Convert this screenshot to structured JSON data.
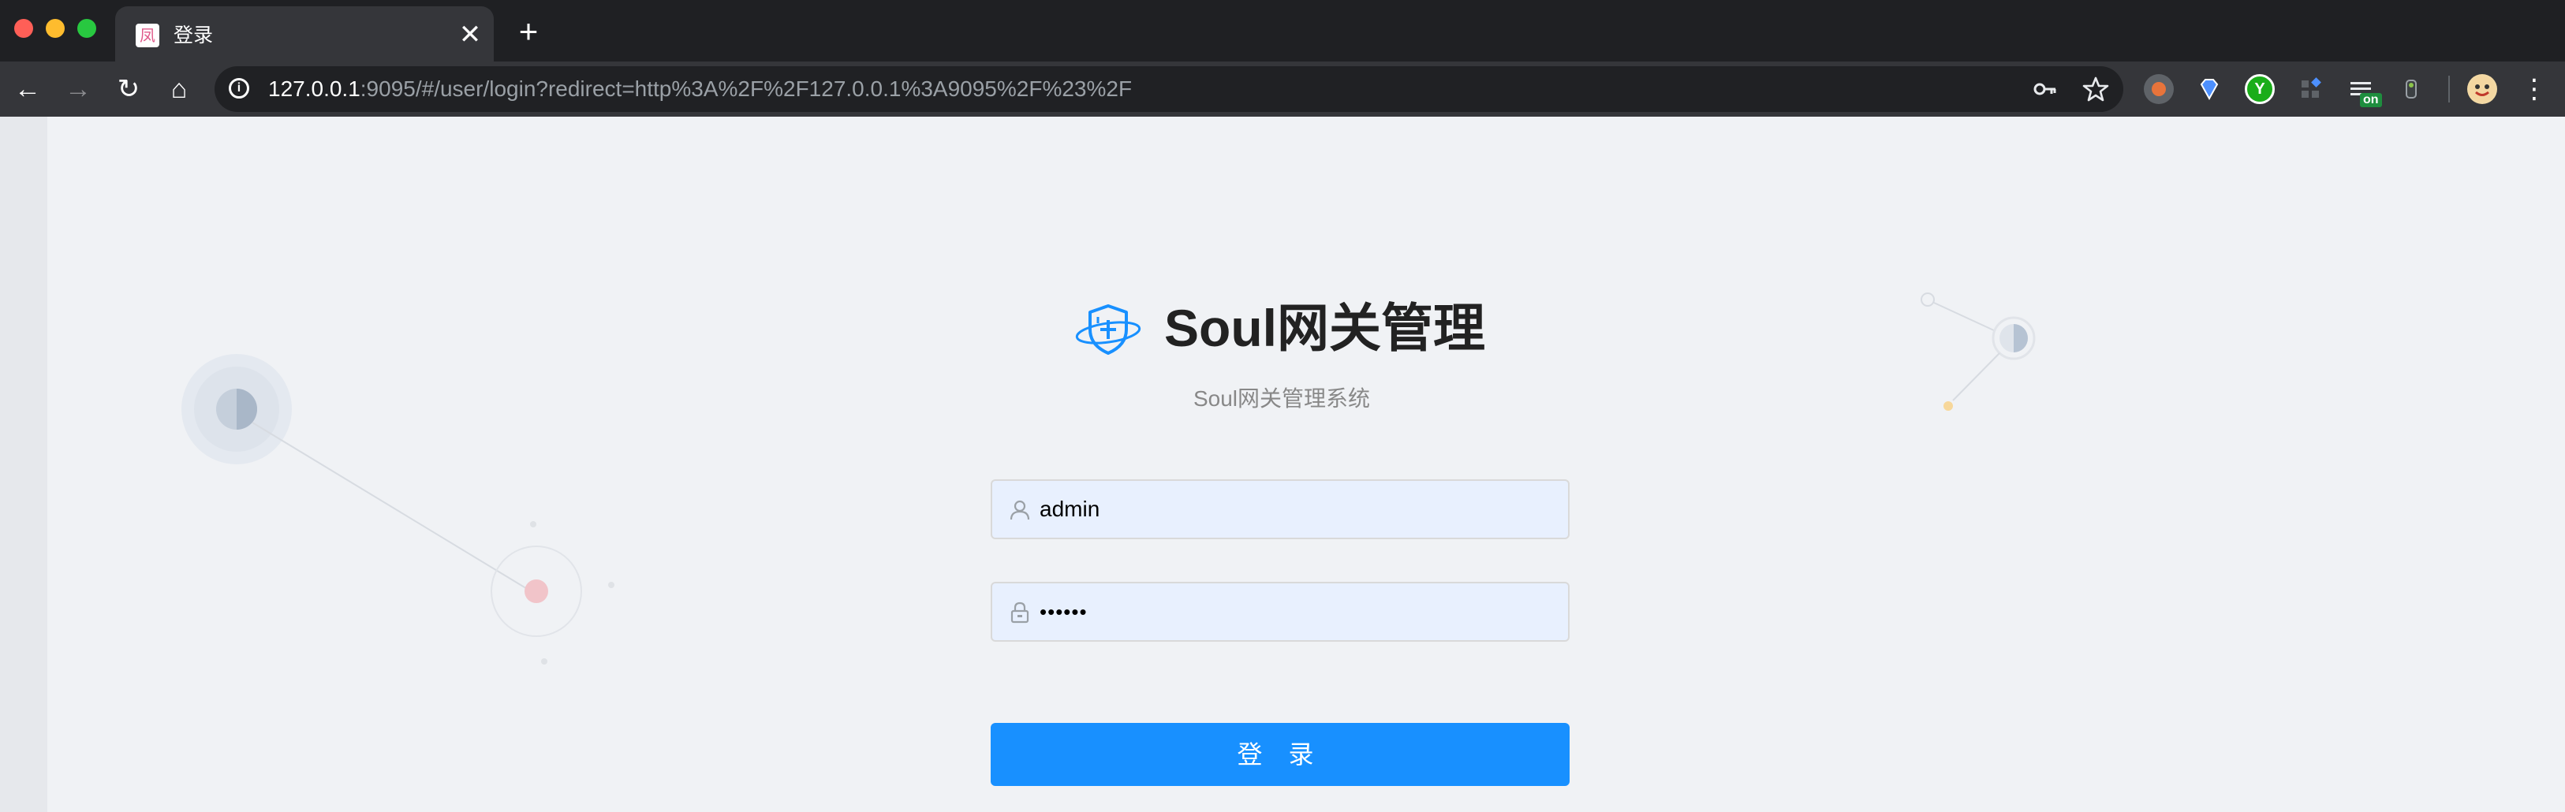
{
  "browser": {
    "tab": {
      "favicon_glyph": "凤",
      "title": "登录",
      "close_glyph": "✕"
    },
    "new_tab_glyph": "+",
    "nav": {
      "back": "←",
      "forward": "→",
      "reload": "↻",
      "home": "⌂"
    },
    "url": {
      "host": "127.0.0.1",
      "rest": ":9095/#/user/login?redirect=http%3A%2F%2F127.0.0.1%3A9095%2F%23%2F"
    },
    "omnibox_icons": {
      "key": "key-icon",
      "star": "star-icon"
    },
    "extensions": [
      {
        "name": "extension-orange-dot-icon"
      },
      {
        "name": "extension-diamond-icon"
      },
      {
        "name": "extension-y-icon",
        "glyph": "Y"
      },
      {
        "name": "extension-grid-icon"
      },
      {
        "name": "extension-list-on-icon",
        "badge": "on"
      },
      {
        "name": "extension-puzzle-icon"
      }
    ],
    "menu_glyph": "⋮"
  },
  "login": {
    "title": "Soul网关管理",
    "subtitle": "Soul网关管理系统",
    "username": {
      "value": "admin",
      "icon": "user-icon"
    },
    "password": {
      "value": "••••••",
      "icon": "lock-icon"
    },
    "submit_label": "登 录"
  },
  "colors": {
    "primary": "#1890ff",
    "input_bg": "#e8f0fe",
    "page_bg": "#f0f2f5"
  }
}
